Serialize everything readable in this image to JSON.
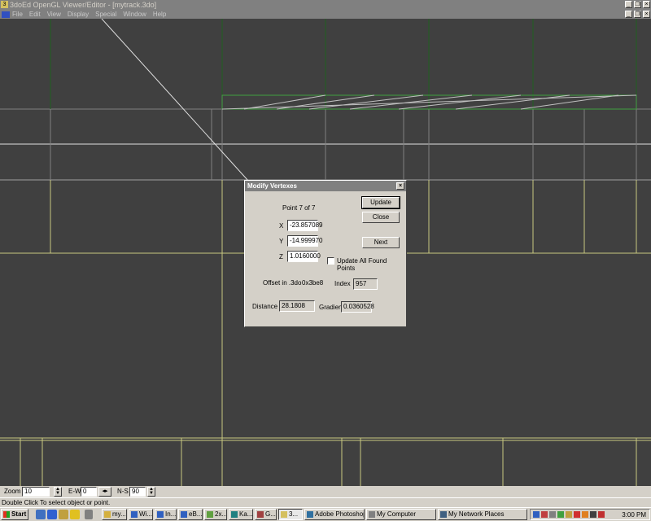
{
  "window": {
    "title": "3doEd OpenGL Viewer/Editor - [mytrack.3do]",
    "app_icon": "3",
    "minimize_glyph": "_",
    "restore_glyph": "❐",
    "close_glyph": "×"
  },
  "menu": {
    "items": [
      "File",
      "Edit",
      "View",
      "Display",
      "Special",
      "Window",
      "Help"
    ]
  },
  "dialog": {
    "title": "Modify Vertexes",
    "close_glyph": "×",
    "point_label": "Point 7 of 7",
    "x_label": "X",
    "y_label": "Y",
    "z_label": "Z",
    "x_value": "-23.857089",
    "y_value": "-14.999970",
    "z_value": "1.0160000",
    "update_button": "Update",
    "close_button": "Close",
    "next_button": "Next",
    "update_all_label": "Update All Found Points",
    "update_all_checked": false,
    "offset_label": "Offset in .3do",
    "offset_value": "0x3be8",
    "index_label": "Index",
    "index_value": "957",
    "distance_label": "Distance",
    "distance_value": "28.1808",
    "gradient_label": "Gradient",
    "gradient_value": "0.0360528"
  },
  "toolbar": {
    "zoom_label": "Zoom",
    "zoom_value": "10",
    "ew_label": "E-W",
    "ew_value": "0",
    "ns_label": "N-S",
    "ns_value": "90"
  },
  "status": {
    "text": "Double Click To select object or point."
  },
  "taskbar": {
    "start_label": "Start",
    "tasks": [
      {
        "label": "my...",
        "icon": "folder-icon",
        "color": "#d4b040"
      },
      {
        "label": "Wi...",
        "icon": "ie-icon",
        "color": "#3060c0"
      },
      {
        "label": "In...",
        "icon": "ie-icon",
        "color": "#3060c0"
      },
      {
        "label": "eB...",
        "icon": "ie-icon",
        "color": "#3060c0"
      },
      {
        "label": "2x...",
        "icon": "app-icon",
        "color": "#60a040"
      },
      {
        "label": "Ka...",
        "icon": "app-icon",
        "color": "#208080"
      },
      {
        "label": "G...",
        "icon": "app-icon",
        "color": "#a04040"
      },
      {
        "label": "3...",
        "icon": "3doed-icon",
        "color": "#d4c060"
      },
      {
        "label": "Adobe Photoshop",
        "icon": "photoshop-icon",
        "color": "#3070a0"
      },
      {
        "label": "My Computer",
        "icon": "computer-icon",
        "color": "#808080"
      },
      {
        "label": "My Network Places",
        "icon": "network-icon",
        "color": "#406080"
      }
    ],
    "clock": "3:00 PM"
  },
  "colors": {
    "viewport_bg": "#404040",
    "grid_dim": "#808080",
    "grid_yellow": "#c8c880",
    "grid_green": "#206020",
    "grid_white": "#e0e0e0",
    "wire_green": "#40a040"
  }
}
